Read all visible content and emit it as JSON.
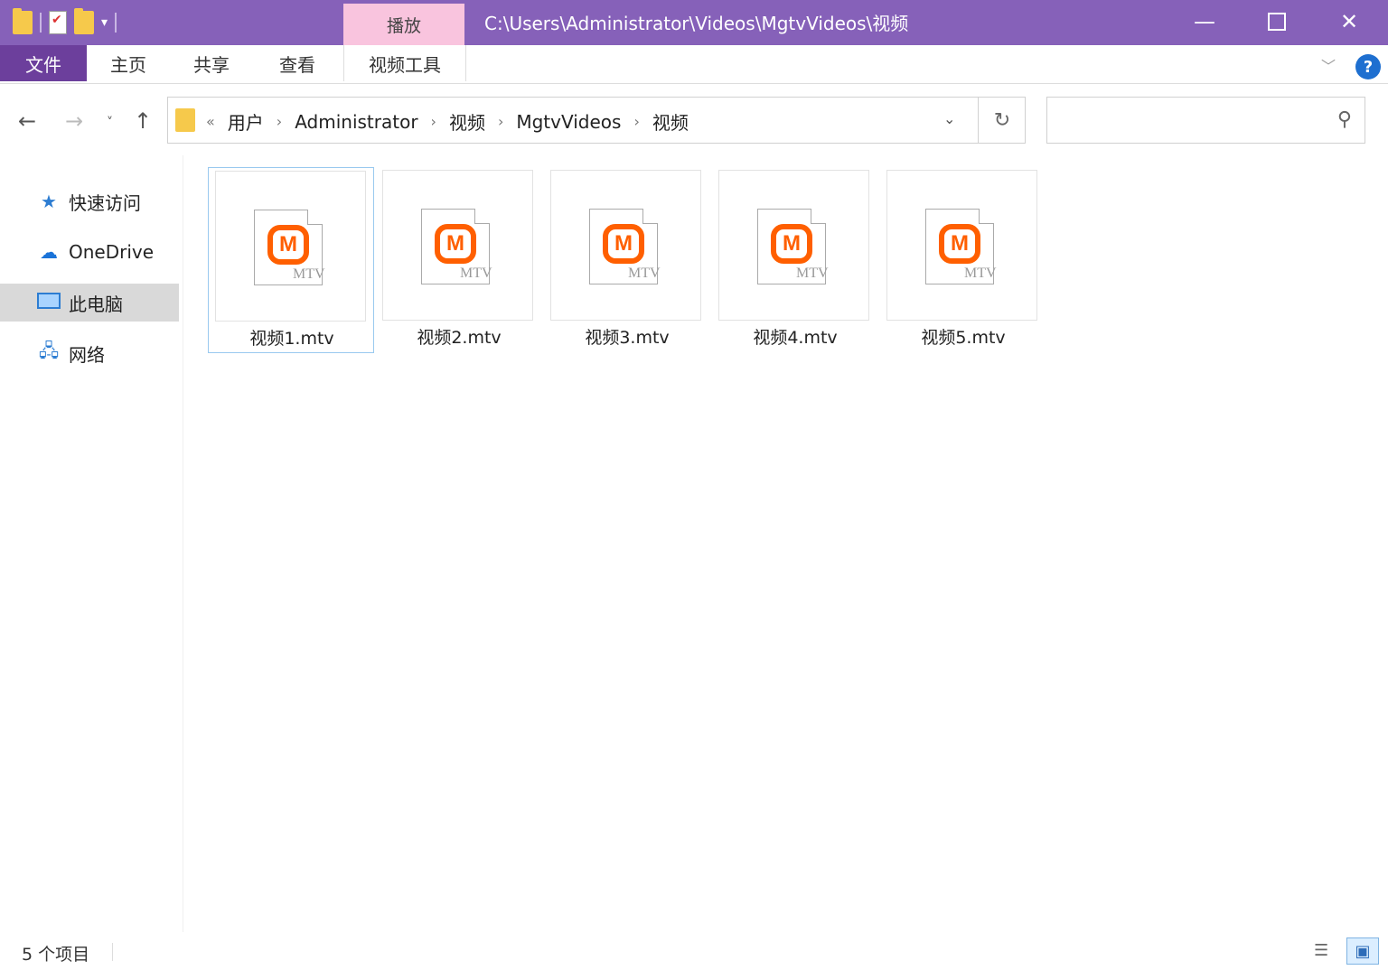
{
  "titlebar": {
    "title": "C:\\Users\\Administrator\\Videos\\MgtvVideos\\视频",
    "context_tab": "播放",
    "minimize_icon": "minimize-icon",
    "maximize_icon": "maximize-icon",
    "close_icon": "close-icon",
    "min_glyph": "—",
    "close_glyph": "✕"
  },
  "ribbon": {
    "tabs": [
      "文件",
      "主页",
      "共享",
      "查看",
      "视频工具"
    ],
    "expand_glyph": "﹀",
    "help_glyph": "?"
  },
  "nav": {
    "back_glyph": "←",
    "forward_glyph": "→",
    "recent_glyph": "˅",
    "up_glyph": "↑",
    "overflow": "«",
    "breadcrumbs": [
      "用户",
      "Administrator",
      "视频",
      "MgtvVideos",
      "视频"
    ],
    "chev": "›",
    "dropdown_glyph": "⌄",
    "refresh_glyph": "↻",
    "search_placeholder": "",
    "search_glyph": "⚲"
  },
  "sidebar": {
    "items": [
      {
        "label": "快速访问",
        "icon": "star-icon",
        "glyph": "★"
      },
      {
        "label": "OneDrive",
        "icon": "cloud-icon",
        "glyph": "☁"
      },
      {
        "label": "此电脑",
        "icon": "computer-icon"
      },
      {
        "label": "网络",
        "icon": "network-icon",
        "glyph": "🖧"
      }
    ]
  },
  "files": [
    {
      "name": "视频1.mtv",
      "logo": "M",
      "badge": "MTV"
    },
    {
      "name": "视频2.mtv",
      "logo": "M",
      "badge": "MTV"
    },
    {
      "name": "视频3.mtv",
      "logo": "M",
      "badge": "MTV"
    },
    {
      "name": "视频4.mtv",
      "logo": "M",
      "badge": "MTV"
    },
    {
      "name": "视频5.mtv",
      "logo": "M",
      "badge": "MTV"
    }
  ],
  "status": {
    "count": "5 个项目",
    "details_glyph": "☰",
    "thumb_glyph": "▣"
  },
  "colors": {
    "titlebar": "#8661b9",
    "context_tab": "#f9c4de",
    "file_tab": "#6c3f9c",
    "mgtv_orange": "#ff5f00"
  }
}
